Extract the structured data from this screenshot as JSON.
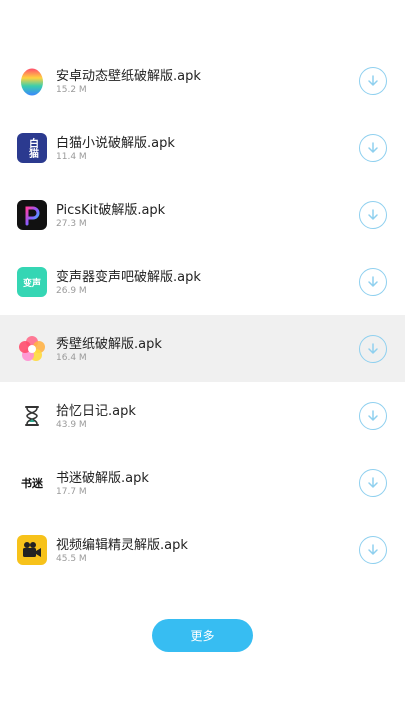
{
  "apps": [
    {
      "title": "安卓动态壁纸破解版.apk",
      "size": "15.2 M",
      "icon": "egg-icon"
    },
    {
      "title": "白猫小说破解版.apk",
      "size": "11.4 M",
      "icon": "baimao-icon",
      "icon_text": "白猫"
    },
    {
      "title": "PicsKit破解版.apk",
      "size": "27.3 M",
      "icon": "picskit-icon"
    },
    {
      "title": "变声器变声吧破解版.apk",
      "size": "26.9 M",
      "icon": "voice-changer-icon",
      "icon_text": "变声"
    },
    {
      "title": "秀壁纸破解版.apk",
      "size": "16.4 M",
      "icon": "flower-icon"
    },
    {
      "title": "拾忆日记.apk",
      "size": "43.9 M",
      "icon": "hourglass-icon"
    },
    {
      "title": "书迷破解版.apk",
      "size": "17.7 M",
      "icon": "calligraphy-icon",
      "icon_text": "书迷"
    },
    {
      "title": "视频编辑精灵解版.apk",
      "size": "45.5 M",
      "icon": "video-camera-icon"
    }
  ],
  "highlighted_index": 4,
  "more_label": "更多",
  "colors": {
    "accent": "#37bdf2",
    "download_ring": "#8fd0ef",
    "highlight": "#f0f0f0"
  }
}
